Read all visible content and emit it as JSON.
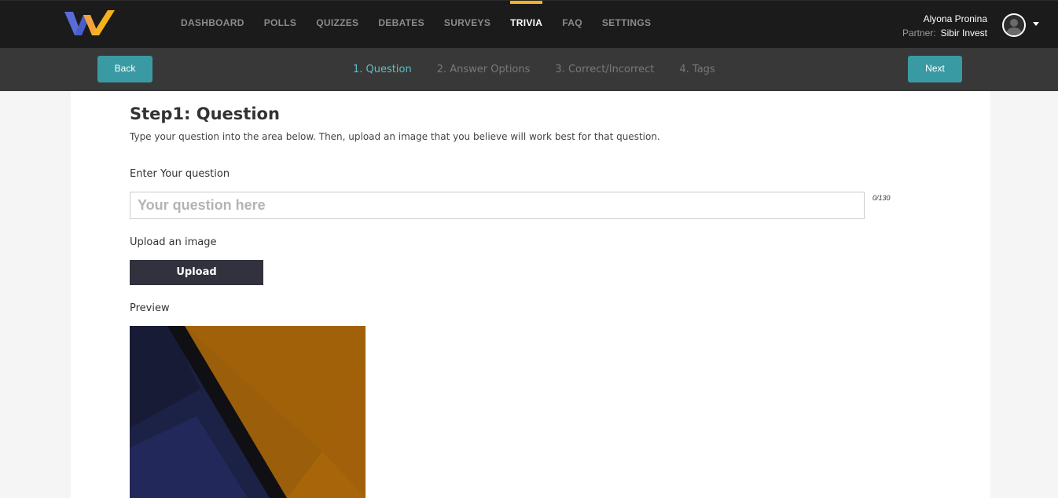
{
  "nav": {
    "items": [
      "DASHBOARD",
      "POLLS",
      "QUIZZES",
      "DEBATES",
      "SURVEYS",
      "TRIVIA",
      "FAQ",
      "SETTINGS"
    ],
    "active": "TRIVIA"
  },
  "user": {
    "name": "Alyona Pronina",
    "partner_label": "Partner:",
    "partner_name": "Sibir Invest"
  },
  "stepbar": {
    "back_label": "Back",
    "next_label": "Next",
    "steps": [
      "1. Question",
      "2. Answer Options",
      "3. Correct/Incorrect",
      "4. Tags"
    ],
    "active_step": "1. Question"
  },
  "content": {
    "title": "Step1: Question",
    "subtitle": "Type your question into the area below. Then, upload an image that you believe will work best for that question.",
    "question_label": "Enter Your question",
    "question_value": "",
    "question_placeholder": "Your question here",
    "counter": "0/130",
    "upload_label": "Upload an image",
    "upload_button": "Upload",
    "preview_label": "Preview"
  },
  "colors": {
    "accent_teal": "#3a9aa3",
    "active_step": "#5bc0c8",
    "nav_active_bar": "#f5b21d",
    "topbar_bg": "#1b1b1b",
    "stepbar_bg": "#383838"
  },
  "icons": {
    "logo": "w-logo-icon",
    "avatar": "user-avatar-icon",
    "dropdown": "caret-down-icon"
  }
}
